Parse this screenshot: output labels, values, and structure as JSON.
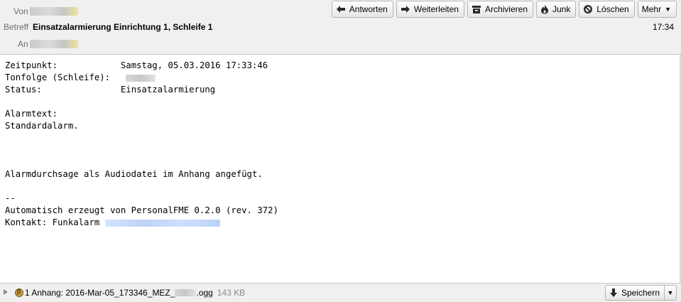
{
  "header": {
    "from_label": "Von",
    "subject_label": "Betreff",
    "subject": "Einsatzalarmierung Einrichtung 1, Schleife 1",
    "to_label": "An",
    "time": "17:34"
  },
  "toolbar": {
    "reply": "Antworten",
    "forward": "Weiterleiten",
    "archive": "Archivieren",
    "junk": "Junk",
    "delete": "Löschen",
    "more": "Mehr"
  },
  "body": {
    "zeitpunkt_label": "Zeitpunkt:",
    "zeitpunkt_value": "Samstag, 05.03.2016 17:33:46",
    "tonfolge_label": "Tonfolge (Schleife):",
    "status_label": "Status:",
    "status_value": "Einsatzalarmierung",
    "alarmtext_label": "Alarmtext:",
    "alarmtext_value": "Standardalarm.",
    "audio_note": "Alarmdurchsage als Audiodatei im Anhang angefügt.",
    "sig_separator": "--",
    "sig_line1": "Automatisch erzeugt von PersonalFME 0.2.0 (rev. 372)",
    "sig_contact": "Kontakt: Funkalarm "
  },
  "attachment": {
    "summary_prefix": "1 Anhang: 2016-Mar-05_173346_MEZ_",
    "summary_suffix": ".ogg",
    "size": "143 KB",
    "save_label": "Speichern"
  }
}
